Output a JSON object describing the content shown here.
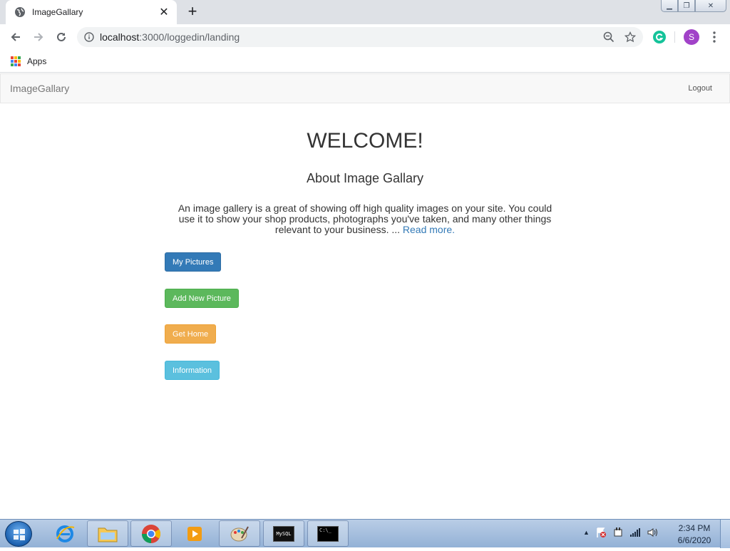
{
  "browser": {
    "tab_title": "ImageGallary",
    "url_host": "localhost",
    "url_rest": ":3000/loggedin/landing",
    "bookmark_apps": "Apps",
    "profile_initial": "S",
    "icons": {
      "back": "arrow-left-icon",
      "forward": "arrow-right-icon",
      "reload": "reload-icon",
      "info": "info-icon",
      "zoom": "zoom-out-icon",
      "star": "star-icon",
      "extension": "grammarly-icon",
      "menu": "kebab-menu-icon"
    }
  },
  "navbar": {
    "brand": "ImageGallary",
    "logout": "Logout"
  },
  "main": {
    "heading": "WELCOME!",
    "subheading": "About Image Gallary",
    "description": "An image gallery is a great of showing off high quality images on your site. You could use it to show your shop products, photographs you've taken, and many other things relevant to your business. ... ",
    "read_more": "Read more.",
    "buttons": {
      "my_pictures": "My Pictures",
      "add_new_picture": "Add New Picture",
      "get_home": "Get Home",
      "information": "Information"
    }
  },
  "taskbar": {
    "time": "2:34 PM",
    "date": "6/6/2020",
    "mysql_label": "MySQL"
  },
  "colors": {
    "primary": "#337ab7",
    "success": "#5cb85c",
    "warning": "#f0ad4e",
    "info": "#5bc0de",
    "profile": "#a142c8"
  }
}
